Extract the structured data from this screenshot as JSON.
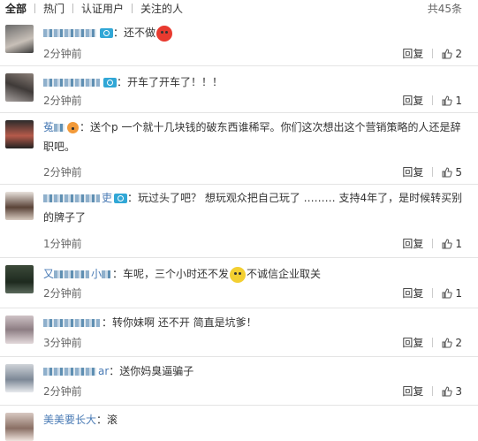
{
  "tabs": [
    "全部",
    "热门",
    "认证用户",
    "关注的人"
  ],
  "total": "共45条",
  "reply_label": "回复",
  "comments": [
    {
      "username": "",
      "text": "：还不做",
      "emoji": "angry-face-icon",
      "time": "2分钟前",
      "likes": "2"
    },
    {
      "username": "",
      "text": "：开车了开车了！！！",
      "time": "2分钟前",
      "likes": "1"
    },
    {
      "username": "菟",
      "text": "：送个p 一个就十几块钱的破东西谁稀罕。你们这次想出这个营销策略的人还是辞职吧。",
      "time": "2分钟前",
      "likes": "5"
    },
    {
      "username": "吏",
      "text": "：玩过头了吧？ 想玩观众把自己玩了 ……… 支持4年了，是时候转买别的牌子了",
      "time": "1分钟前",
      "likes": "1"
    },
    {
      "username": "又",
      "username2": "小",
      "text_before": "：车呢，三个小时还不发",
      "emoji": "thinking-face-icon",
      "text_after": "不诚信企业取关",
      "time": "2分钟前",
      "likes": "1"
    },
    {
      "username": "",
      "text": "：转你妹啊 还不开 简直是坑爹！",
      "time": "3分钟前",
      "likes": "2"
    },
    {
      "username": "ar",
      "text": "：送你妈臭逼骗子",
      "time": "2分钟前",
      "likes": "3"
    },
    {
      "username": "美美要长大",
      "text": "：滚"
    }
  ],
  "colors": {
    "username": "#4a7bb5",
    "badge": "#31a7d6",
    "divider": "#e4e4e4"
  }
}
